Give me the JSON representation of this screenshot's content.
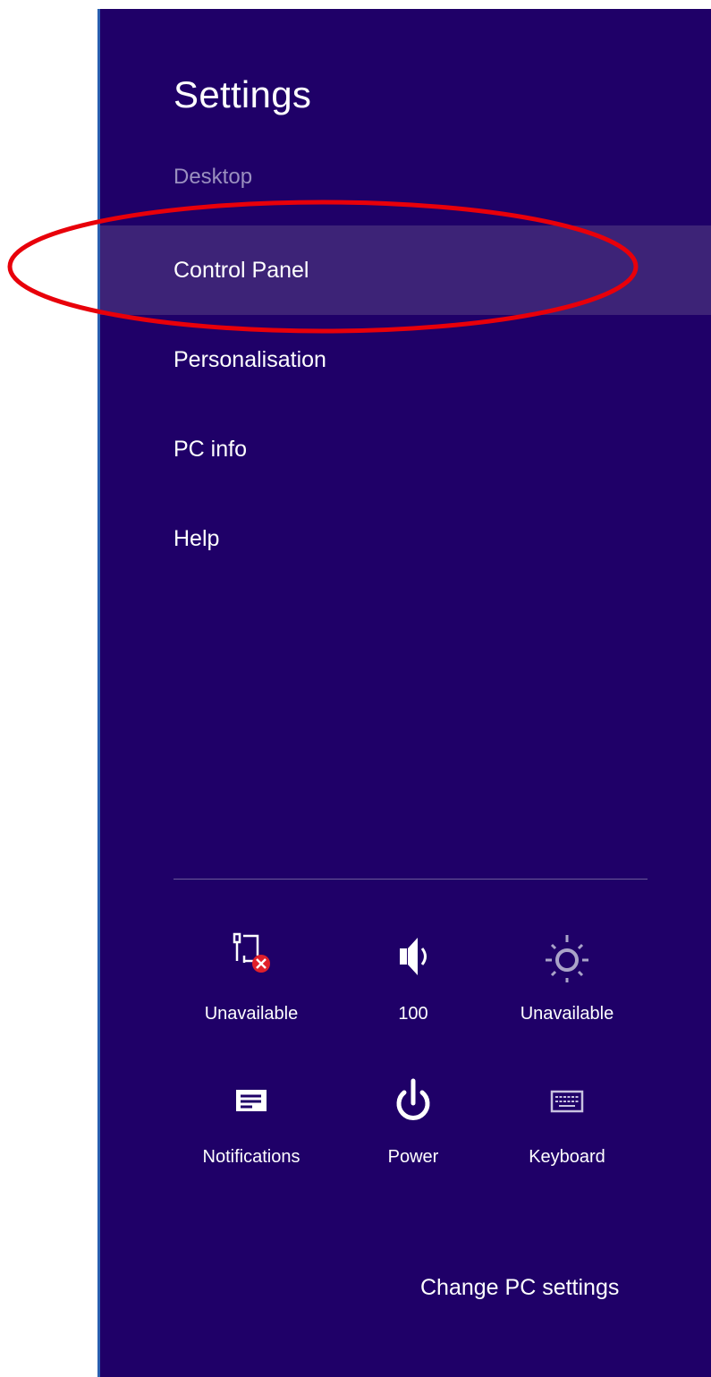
{
  "panel": {
    "title": "Settings",
    "subtitle": "Desktop",
    "menu": [
      {
        "label": "Control Panel"
      },
      {
        "label": "Personalisation"
      },
      {
        "label": "PC info"
      },
      {
        "label": "Help"
      }
    ],
    "quick_settings": [
      {
        "icon": "network-unavailable-icon",
        "label": "Unavailable"
      },
      {
        "icon": "volume-icon",
        "label": "100"
      },
      {
        "icon": "brightness-icon",
        "label": "Unavailable"
      },
      {
        "icon": "notifications-icon",
        "label": "Notifications"
      },
      {
        "icon": "power-icon",
        "label": "Power"
      },
      {
        "icon": "keyboard-icon",
        "label": "Keyboard"
      }
    ],
    "change_pc_settings": "Change PC settings"
  },
  "colors": {
    "panel_bg": "#1f0068",
    "selected_bg": "#3d2377",
    "annotation": "#e8000a",
    "error": "#e0202a"
  }
}
